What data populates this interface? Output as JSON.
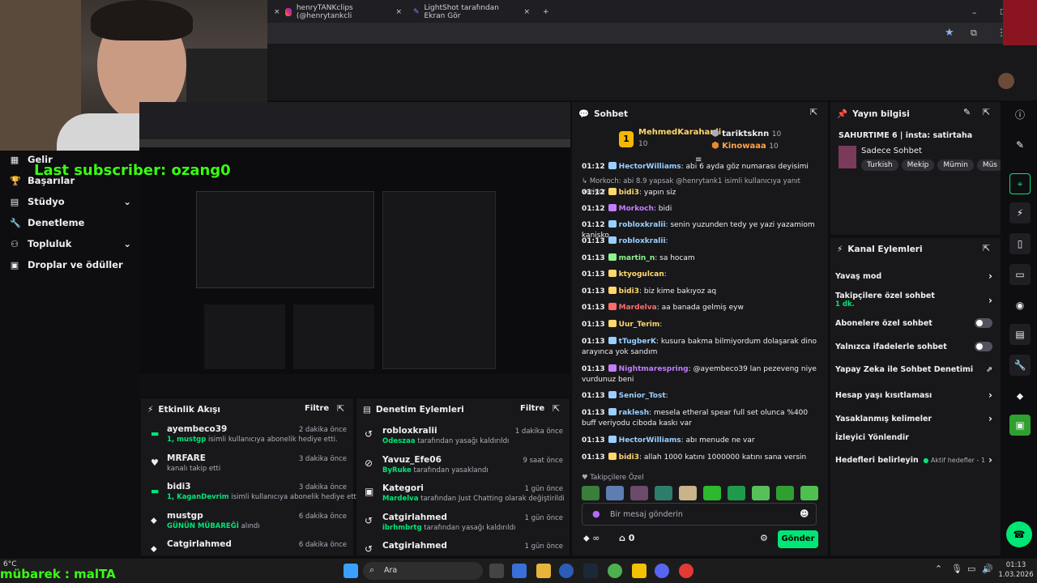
{
  "browser": {
    "tabs": [
      {
        "label": "henryTANKclips (@henrytankcli",
        "icon": "instagram-icon"
      },
      {
        "label": "LightShot tarafından Ekran Gör",
        "icon": "lightshot-icon"
      }
    ]
  },
  "overlay": {
    "last_subscriber": "Last subscriber: ozang0",
    "bottom_text": "mübarek : malTA",
    "weather": "6°C"
  },
  "sidenav": {
    "items": [
      {
        "label": "Gelir",
        "icon": "dashboard-icon"
      },
      {
        "label": "Başarılar",
        "icon": "trophy-icon"
      },
      {
        "label": "Stüdyo",
        "icon": "studio-icon"
      },
      {
        "label": "Denetleme",
        "icon": "wrench-icon"
      },
      {
        "label": "Topluluk",
        "icon": "community-icon"
      },
      {
        "label": "Droplar ve ödüller",
        "icon": "gift-icon"
      }
    ]
  },
  "activity_feed": {
    "title": "Etkinlik Akışı",
    "filter": "Filtre",
    "items": [
      {
        "user": "ayembeco39",
        "line1": "1, mustgp",
        "line1_rest": " isimli kullanıcıya abonelik hediye etti.",
        "time": "2 dakika önce",
        "icon": "gift-sub-icon"
      },
      {
        "user": "MRFARE",
        "line1": "",
        "line1_rest": "kanalı takip etti",
        "time": "3 dakika önce",
        "icon": "heart-icon"
      },
      {
        "user": "bidi3",
        "line1": "1, KaganDevrim",
        "line1_rest": " isimli kullanıcıya abonelik hediye etti.",
        "time": "3 dakika önce",
        "icon": "gift-sub-icon"
      },
      {
        "user": "mustgp",
        "line1": "GÜNÜN MÜBAREĞİ",
        "line1_rest": " alındı",
        "time": "6 dakika önce",
        "icon": "points-icon"
      },
      {
        "user": "Catgirlahmed",
        "line1": "",
        "line1_rest": "",
        "time": "6 dakika önce",
        "icon": "points-icon"
      }
    ]
  },
  "mod_actions": {
    "title": "Denetim Eylemleri",
    "filter": "Filtre",
    "items": [
      {
        "user": "robloxkralii",
        "actor": "Odeszaa",
        "rest": " tarafından yasağı kaldırıldı",
        "time": "1 dakika önce",
        "icon": "unban-icon"
      },
      {
        "user": "Yavuz_Efe06",
        "actor": "ByRuke",
        "rest": " tarafından yasaklandı",
        "time": "9 saat önce",
        "icon": "ban-icon"
      },
      {
        "user": "Kategori",
        "actor": "Mardelva",
        "rest": " tarafından Just Chatting olarak değiştirildi",
        "time": "1 gün önce",
        "icon": "category-icon"
      },
      {
        "user": "Catgirlahmed",
        "actor": "ibrhmbrtg",
        "rest": " tarafından yasağı kaldırıldı",
        "time": "1 gün önce",
        "icon": "unban-icon"
      },
      {
        "user": "Catgirlahmed",
        "actor": "",
        "rest": "",
        "time": "1 gün önce",
        "icon": "unban-icon"
      }
    ]
  },
  "chat": {
    "title": "Sohbet",
    "leaderboard": [
      {
        "rank": "1",
        "name": "MehmedKarahanli",
        "score": "10"
      },
      {
        "rank": "",
        "name": "tariktsknn",
        "score": "10"
      },
      {
        "rank": "",
        "name": "Kinowaaa",
        "score": "10"
      }
    ],
    "messages": [
      {
        "time": "01:12",
        "user": "HectorWilliams",
        "color": "#9ad0ff",
        "text": ": abi 6 ayda göz numarası deyisimi"
      },
      {
        "time": "",
        "user": "",
        "color": "#adadb8",
        "text": "↳ Morkoch: abi 8.9 yapsak @henrytank1 isimli kullanıcıya yanıt veriyor"
      },
      {
        "time": "01:12",
        "user": "bidi3",
        "color": "#ffd86b",
        "text": ": yapın siz"
      },
      {
        "time": "01:12",
        "user": "Morkoch",
        "color": "#c47dff",
        "text": ": bidi"
      },
      {
        "time": "01:12",
        "user": "robloxkralii",
        "color": "#9ad0ff",
        "text": ": senin yuzunden tedy ye yazi yazamiom kanisko"
      },
      {
        "time": "01:13",
        "user": "robloxkralii",
        "color": "#9ad0ff",
        "text": ":"
      },
      {
        "time": "01:13",
        "user": "martin_n",
        "color": "#8ef58e",
        "text": ": sa hocam"
      },
      {
        "time": "01:13",
        "user": "ktyogulcan",
        "color": "#ffd86b",
        "text": ":"
      },
      {
        "time": "01:13",
        "user": "bidi3",
        "color": "#ffd86b",
        "text": ": biz kime bakıyoz aq"
      },
      {
        "time": "01:13",
        "user": "Mardelva",
        "color": "#ff6b6b",
        "text": ": aa banada gelmiş eyw"
      },
      {
        "time": "01:13",
        "user": "Uur_Terim",
        "color": "#ffd86b",
        "text": ":"
      },
      {
        "time": "01:13",
        "user": "tTugberK",
        "color": "#9ad0ff",
        "text": ": kusura bakma bilmiyordum dolaşarak dino arayınca yok sandım"
      },
      {
        "time": "01:13",
        "user": "Nightmarespring",
        "color": "#c47dff",
        "text": ": @ayembeco39 lan pezeveng niye vurdunuz beni"
      },
      {
        "time": "01:13",
        "user": "Senior_Tost",
        "color": "#9ad0ff",
        "text": ":"
      },
      {
        "time": "01:13",
        "user": "raklesh",
        "color": "#9ad0ff",
        "text": ": mesela etheral spear full set olunca %400 buff veriyodu ciboda kaskı var"
      },
      {
        "time": "01:13",
        "user": "HectorWilliams",
        "color": "#9ad0ff",
        "text": ": abı menude ne var"
      },
      {
        "time": "01:13",
        "user": "bidi3",
        "color": "#ffd86b",
        "text": ": allah 1000 katını 1000000 katını sana versin"
      }
    ],
    "follower_only_label": "Takipçilere Özel",
    "input_placeholder": "Bir mesaj gönderin",
    "points": "0",
    "send_label": "Gönder"
  },
  "stream_info": {
    "title": "Yayın bilgisi",
    "stream_title": "SAHURTIME 6 | insta: satirtaha",
    "category": "Sadece Sohbet",
    "tags": [
      "Turkish",
      "Mekip",
      "Mümin",
      "Müs"
    ]
  },
  "channel_actions": {
    "title": "Kanal Eylemleri",
    "items": [
      {
        "label": "Yavaş mod",
        "sub": "",
        "control": "arrow"
      },
      {
        "label": "Takipçilere özel sohbet",
        "sub": "1 dk.",
        "control": "arrow"
      },
      {
        "label": "Abonelere özel sohbet",
        "sub": "",
        "control": "toggle"
      },
      {
        "label": "Yalnızca ifadelerle sohbet",
        "sub": "",
        "control": "toggle"
      },
      {
        "label": "Yapay Zeka ile Sohbet Denetimi",
        "sub": "",
        "control": "external"
      },
      {
        "label": "Hesap yaşı kısıtlaması",
        "sub": "",
        "control": "arrow"
      },
      {
        "label": "Yasaklanmış kelimeler",
        "sub": "",
        "control": "arrow"
      },
      {
        "label": "İzleyici Yönlendir",
        "sub": "",
        "control": "none"
      },
      {
        "label": "Hedefleri belirleyin",
        "sub": "",
        "control": "arrow",
        "extra": "Aktif hedefler - 1"
      }
    ]
  },
  "taskbar": {
    "search": "Ara",
    "time": "01:13",
    "date": "1.03.2026"
  },
  "colors": {
    "accent_green": "#00e676",
    "panel": "#18181b",
    "background": "#0e0e10"
  }
}
